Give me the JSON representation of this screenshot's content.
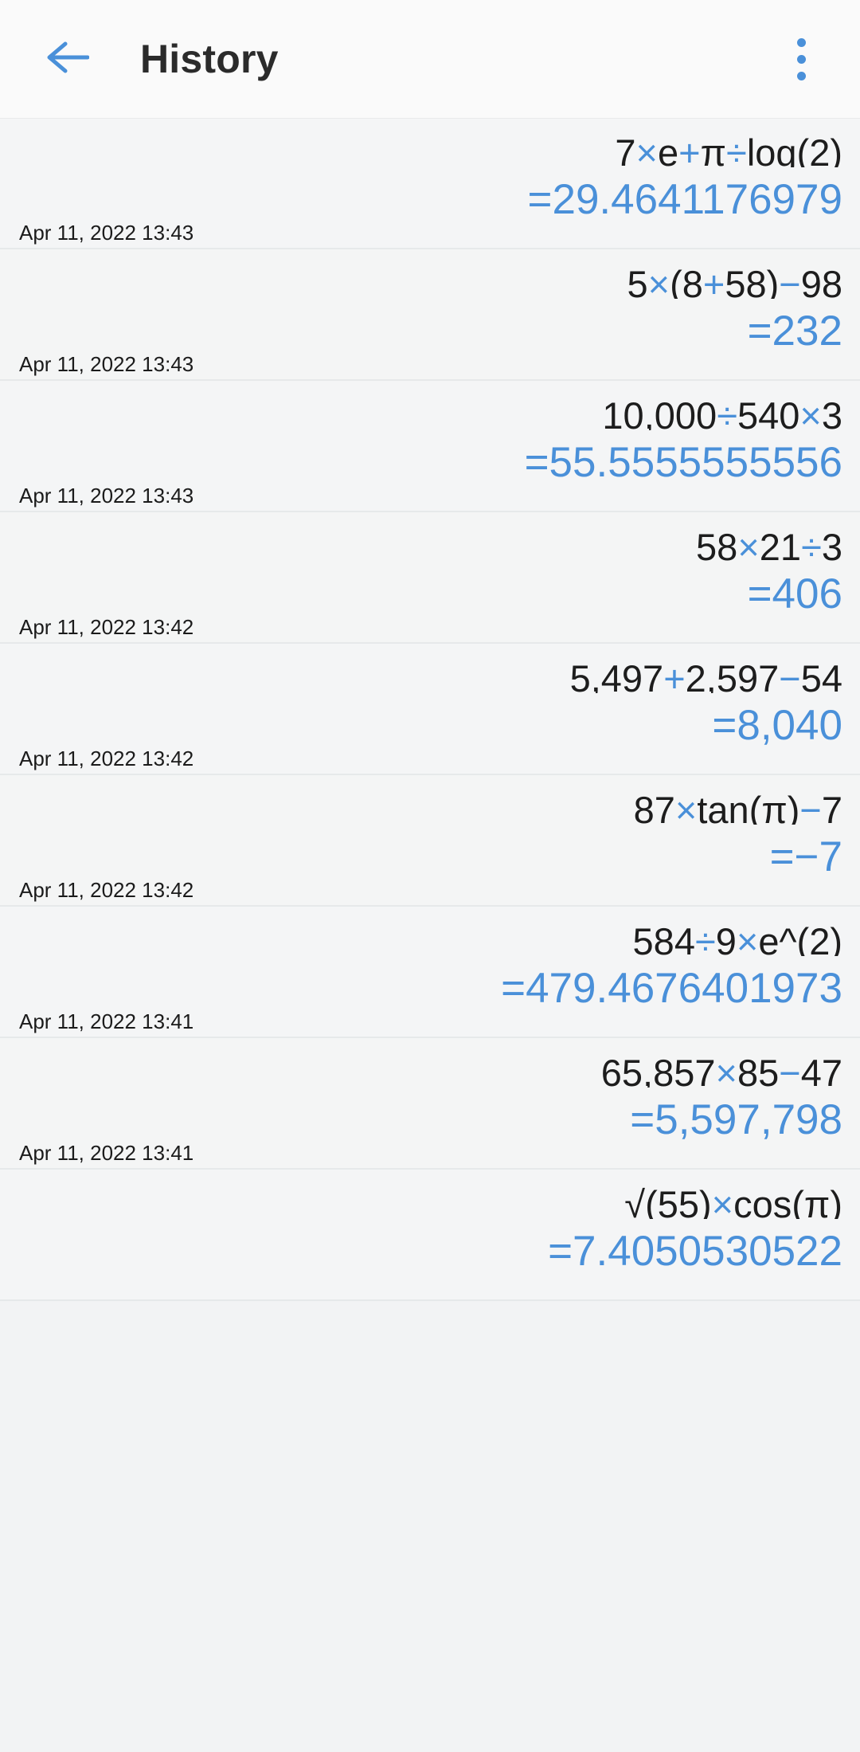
{
  "appbar": {
    "back_icon": "arrow-left-icon",
    "title": "History",
    "overflow_icon": "more-vertical-icon",
    "accent_color": "#4a90d9",
    "title_color": "#2b2b2b"
  },
  "theme": {
    "background": "#f2f3f4",
    "row_background": "#f4f5f6",
    "divider": "#e6e9ea",
    "expression_color": "#1d1d1d",
    "operator_color": "#4a90d9",
    "result_color": "#4a90d9",
    "timestamp_color": "#1b1b1b"
  },
  "history": {
    "items": [
      {
        "expression": "7×e+π÷log(2)",
        "expression_parts": [
          {
            "t": "7",
            "op": false
          },
          {
            "t": "×",
            "op": true
          },
          {
            "t": "e",
            "op": false
          },
          {
            "t": "+",
            "op": true
          },
          {
            "t": "π",
            "op": false
          },
          {
            "t": "÷",
            "op": true
          },
          {
            "t": "log(2)",
            "op": false
          }
        ],
        "result": "=29.4641176979",
        "timestamp": "Apr 11, 2022 13:43"
      },
      {
        "expression": "5×(8+58)−98",
        "expression_parts": [
          {
            "t": "5",
            "op": false
          },
          {
            "t": "×",
            "op": true
          },
          {
            "t": "(8",
            "op": false
          },
          {
            "t": "+",
            "op": true
          },
          {
            "t": "58)",
            "op": false
          },
          {
            "t": "−",
            "op": true
          },
          {
            "t": "98",
            "op": false
          }
        ],
        "result": "=232",
        "timestamp": "Apr 11, 2022 13:43"
      },
      {
        "expression": "10,000÷540×3",
        "expression_parts": [
          {
            "t": "10,000",
            "op": false
          },
          {
            "t": "÷",
            "op": true
          },
          {
            "t": "540",
            "op": false
          },
          {
            "t": "×",
            "op": true
          },
          {
            "t": "3",
            "op": false
          }
        ],
        "result": "=55.5555555556",
        "timestamp": "Apr 11, 2022 13:43"
      },
      {
        "expression": "58×21÷3",
        "expression_parts": [
          {
            "t": "58",
            "op": false
          },
          {
            "t": "×",
            "op": true
          },
          {
            "t": "21",
            "op": false
          },
          {
            "t": "÷",
            "op": true
          },
          {
            "t": "3",
            "op": false
          }
        ],
        "result": "=406",
        "timestamp": "Apr 11, 2022 13:42"
      },
      {
        "expression": "5,497+2,597−54",
        "expression_parts": [
          {
            "t": "5,497",
            "op": false
          },
          {
            "t": "+",
            "op": true
          },
          {
            "t": "2,597",
            "op": false
          },
          {
            "t": "−",
            "op": true
          },
          {
            "t": "54",
            "op": false
          }
        ],
        "result": "=8,040",
        "timestamp": "Apr 11, 2022 13:42"
      },
      {
        "expression": "87×tan(π)−7",
        "expression_parts": [
          {
            "t": "87",
            "op": false
          },
          {
            "t": "×",
            "op": true
          },
          {
            "t": "tan(π)",
            "op": false
          },
          {
            "t": "−",
            "op": true
          },
          {
            "t": "7",
            "op": false
          }
        ],
        "result": "=−7",
        "timestamp": "Apr 11, 2022 13:42"
      },
      {
        "expression": "584÷9×e^(2)",
        "expression_parts": [
          {
            "t": "584",
            "op": false
          },
          {
            "t": "÷",
            "op": true
          },
          {
            "t": "9",
            "op": false
          },
          {
            "t": "×",
            "op": true
          },
          {
            "t": "e^(2)",
            "op": false
          }
        ],
        "result": "=479.4676401973",
        "timestamp": "Apr 11, 2022 13:41"
      },
      {
        "expression": "65,857×85−47",
        "expression_parts": [
          {
            "t": "65,857",
            "op": false
          },
          {
            "t": "×",
            "op": true
          },
          {
            "t": "85",
            "op": false
          },
          {
            "t": "−",
            "op": true
          },
          {
            "t": "47",
            "op": false
          }
        ],
        "result": "=5,597,798",
        "timestamp": "Apr 11, 2022 13:41"
      },
      {
        "expression": "√(55)×cos(π)",
        "expression_parts": [
          {
            "t": "√(55)",
            "op": false
          },
          {
            "t": "×",
            "op": true
          },
          {
            "t": "cos(π)",
            "op": false
          }
        ],
        "result": "=7.4050530522",
        "timestamp": ""
      }
    ]
  }
}
